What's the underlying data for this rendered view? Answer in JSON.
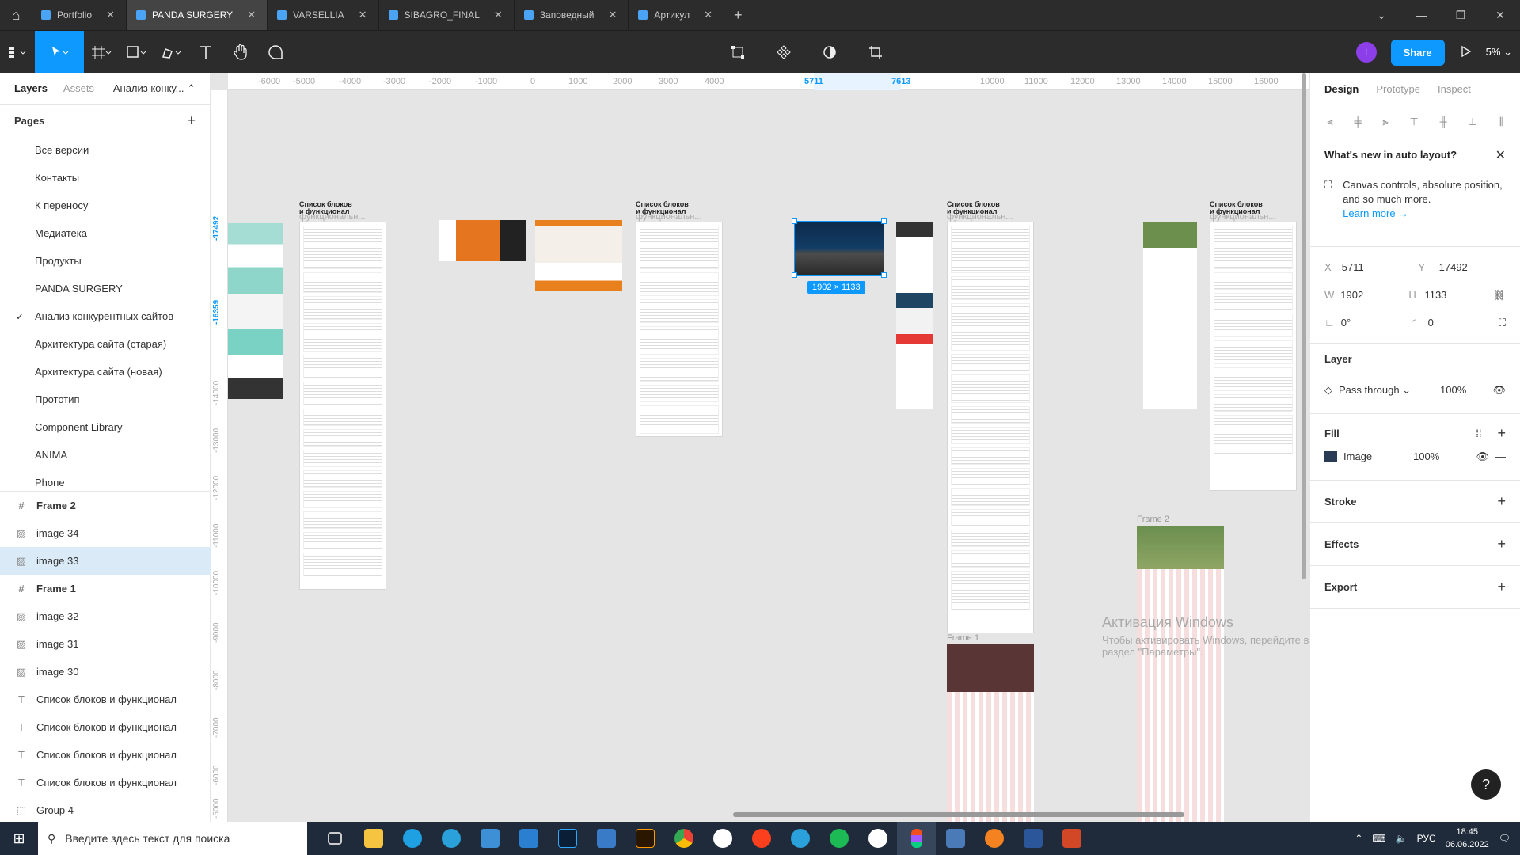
{
  "tabs": [
    {
      "label": "Portfolio",
      "active": false
    },
    {
      "label": "PANDA SURGERY",
      "active": true
    },
    {
      "label": "VARSELLIA",
      "active": false
    },
    {
      "label": "SIBAGRO_FINAL",
      "active": false
    },
    {
      "label": "Заповедный",
      "active": false
    },
    {
      "label": "Артикул",
      "active": false
    }
  ],
  "toolbar": {
    "avatar_initial": "I",
    "share_label": "Share",
    "zoom": "5%"
  },
  "left_panel": {
    "tab_layers": "Layers",
    "tab_assets": "Assets",
    "page_selector": "Анализ конку...",
    "pages_header": "Pages",
    "pages": [
      "Все версии",
      "Контакты",
      "К переносу",
      "Медиатека",
      "Продукты",
      "PANDA SURGERY",
      "Анализ конкурентных сайтов",
      "Архитектура сайта (старая)",
      "Архитектура сайта (новая)",
      "Прототип",
      "Component Library",
      "ANIMA",
      "Phone"
    ],
    "current_page_index": 6,
    "layers": [
      {
        "label": "Frame 2",
        "kind": "frame"
      },
      {
        "label": "image 34",
        "kind": "image"
      },
      {
        "label": "image 33",
        "kind": "image",
        "selected": true
      },
      {
        "label": "Frame 1",
        "kind": "frame"
      },
      {
        "label": "image 32",
        "kind": "image"
      },
      {
        "label": "image 31",
        "kind": "image"
      },
      {
        "label": "image 30",
        "kind": "image"
      },
      {
        "label": "Список блоков и функционал",
        "kind": "text"
      },
      {
        "label": "Список блоков и функционал",
        "kind": "text"
      },
      {
        "label": "Список блоков и функционал",
        "kind": "text"
      },
      {
        "label": "Список блоков и функционал",
        "kind": "text"
      },
      {
        "label": "Group 4",
        "kind": "group"
      }
    ]
  },
  "right_panel": {
    "tab_design": "Design",
    "tab_prototype": "Prototype",
    "tab_inspect": "Inspect",
    "notice_title": "What's new in auto layout?",
    "notice_body": "Canvas controls, absolute position, and so much more.",
    "notice_link": "Learn more →",
    "x_label": "X",
    "x_value": "5711",
    "y_label": "Y",
    "y_value": "-17492",
    "w_label": "W",
    "w_value": "1902",
    "h_label": "H",
    "h_value": "1133",
    "rotation": "0°",
    "radius": "0",
    "layer_title": "Layer",
    "blend_mode": "Pass through",
    "layer_opacity": "100%",
    "fill_title": "Fill",
    "fill_type": "Image",
    "fill_opacity": "100%",
    "stroke_title": "Stroke",
    "effects_title": "Effects",
    "export_title": "Export"
  },
  "canvas": {
    "hruler": [
      "-6000",
      "-5000",
      "-4000",
      "-3000",
      "-2000",
      "-1000",
      "0",
      "1000",
      "2000",
      "3000",
      "4000",
      "5711",
      "7613",
      "10000",
      "11000",
      "12000",
      "13000",
      "14000",
      "15000",
      "16000"
    ],
    "vruler": [
      "-17492",
      "-16359",
      "-14000",
      "-13000",
      "-12000",
      "-11000",
      "-10000",
      "-9000",
      "-8000",
      "-7000",
      "-6000",
      "-5000"
    ],
    "doc_title_l1": "Список блоков",
    "doc_title_l2": "и функционал",
    "doc_title_l3": "функциональн...",
    "selection_dims": "1902 × 1133",
    "frame2_label": "Frame 2",
    "frame1_label": "Frame 1",
    "watermark_title": "Активация Windows",
    "watermark_text": "Чтобы активировать Windows, перейдите в раздел \"Параметры\"."
  },
  "taskbar": {
    "search_placeholder": "Введите здесь текст для поиска",
    "lang": "РУС",
    "time": "18:45",
    "date": "06.06.2022"
  }
}
